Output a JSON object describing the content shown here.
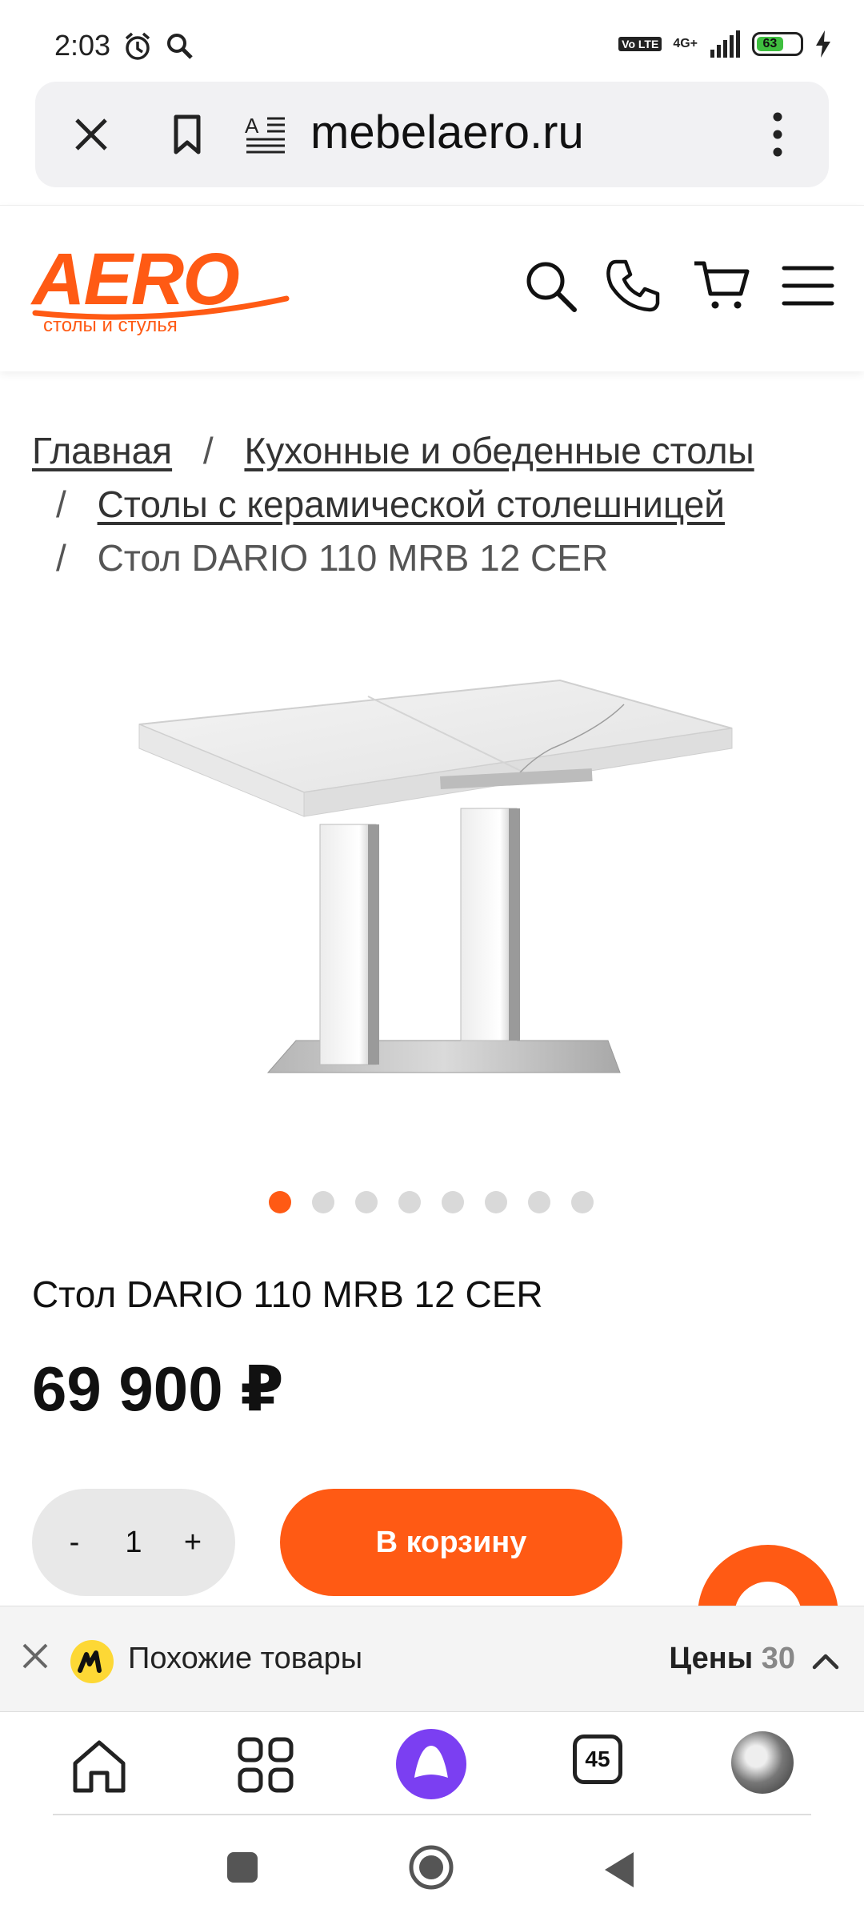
{
  "status_bar": {
    "time": "2:03",
    "network": "4G+",
    "volte": "Vo LTE",
    "battery": "63"
  },
  "browser": {
    "url": "mebelaero.ru",
    "icons": [
      "close-icon",
      "bookmark-icon",
      "reader-mode-icon",
      "more-vert-icon"
    ]
  },
  "header": {
    "logo_text": "AERO",
    "logo_subtitle": "столы и стулья",
    "icons": [
      "search-icon",
      "phone-icon",
      "cart-icon",
      "menu-icon"
    ]
  },
  "breadcrumbs": {
    "home": "Главная",
    "category": "Кухонные и обеденные столы",
    "subcategory": "Столы с керамической столешницей",
    "current": "Стол DARIO 110 MRB 12 CER",
    "separator": "/"
  },
  "gallery": {
    "total": 8,
    "active_index": 0
  },
  "product": {
    "title": "Стол DARIO 110 MRB 12 CER",
    "price": "69 900 ₽",
    "quantity": "1",
    "minus": "-",
    "plus": "+",
    "add_to_cart": "В корзину"
  },
  "similar": {
    "label": "Похожие товары",
    "prices_label": "Цены",
    "prices_count": "30"
  },
  "bottom_nav": {
    "tabs_count": "45",
    "icons": [
      "home-icon",
      "apps-grid-icon",
      "alice-icon",
      "tabs-icon",
      "profile-avatar"
    ]
  },
  "colors": {
    "accent": "#ff5a14",
    "alice": "#7b3ff2"
  }
}
